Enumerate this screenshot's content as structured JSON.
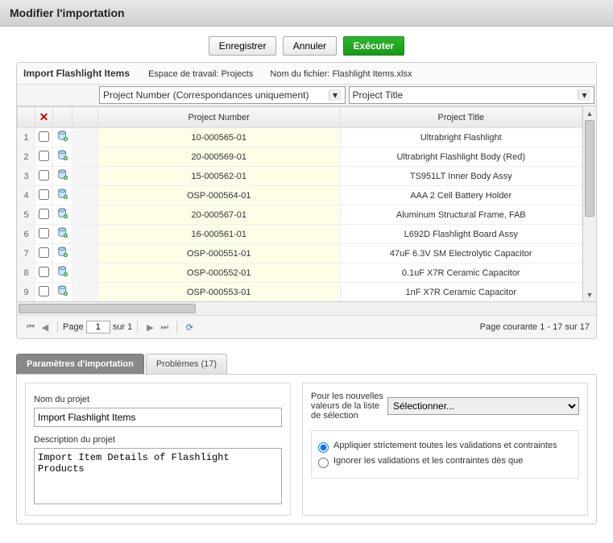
{
  "header": {
    "title": "Modifier l'importation"
  },
  "toolbar": {
    "save": "Enregistrer",
    "cancel": "Annuler",
    "execute": "Exécuter"
  },
  "panel": {
    "name": "Import Flashlight Items",
    "workspace_label": "Espace de travail:",
    "workspace_value": "Projects",
    "filename_label": "Nom du fichier:",
    "filename_value": "Flashlight Items.xlsx"
  },
  "columns": {
    "selector1": "Project Number (Correspondances uniquement)",
    "selector2": "Project Title",
    "header1": "Project Number",
    "header2": "Project Title"
  },
  "rows": [
    {
      "idx": "1",
      "pn": "10-000565-01",
      "title": "Ultrabright Flashlight"
    },
    {
      "idx": "2",
      "pn": "20-000569-01",
      "title": "Ultrabright Flashlight Body (Red)"
    },
    {
      "idx": "3",
      "pn": "15-000562-01",
      "title": "TS951LT Inner Body Assy"
    },
    {
      "idx": "4",
      "pn": "OSP-000564-01",
      "title": "AAA 2 Cell Battery Holder"
    },
    {
      "idx": "5",
      "pn": "20-000567-01",
      "title": "Aluminum Structural Frame, FAB"
    },
    {
      "idx": "6",
      "pn": "16-000561-01",
      "title": "L692D Flashlight Board Assy"
    },
    {
      "idx": "7",
      "pn": "OSP-000551-01",
      "title": "47uF 6.3V SM Electrolytic Capacitor"
    },
    {
      "idx": "8",
      "pn": "OSP-000552-01",
      "title": "0.1uF X7R Ceramic Capacitor"
    },
    {
      "idx": "9",
      "pn": "OSP-000553-01",
      "title": "1nF X7R Ceramic Capacitor"
    }
  ],
  "pager": {
    "page_label_pre": "Page",
    "page_value": "1",
    "page_label_post": "sur 1",
    "status": "Page courante 1 - 17 sur 17"
  },
  "tabs": {
    "settings": "Paramètres d'importation",
    "problems": "Problèmes (17)"
  },
  "form": {
    "project_name_label": "Nom du projet",
    "project_name_value": "Import Flashlight Items",
    "project_desc_label": "Description du projet",
    "project_desc_value": "Import Item Details of Flashlight Products",
    "picklist_label": "Pour les nouvelles valeurs de la liste de sélection",
    "picklist_placeholder": "Sélectionner...",
    "radio1": "Appliquer strictement toutes les validations et contraintes",
    "radio2": "Ignorer les validations et les contraintes dès que"
  }
}
